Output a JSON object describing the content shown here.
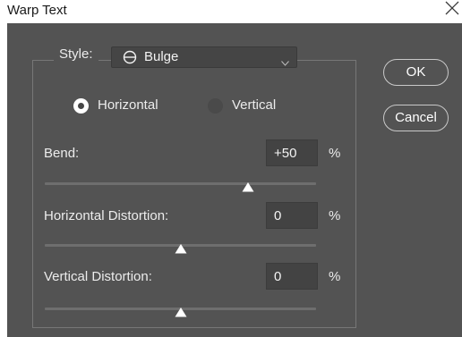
{
  "window": {
    "title": "Warp Text"
  },
  "style": {
    "label": "Style:",
    "selected": "Bulge",
    "icon": "bulge-shape-icon"
  },
  "orientation": {
    "options": [
      {
        "label": "Horizontal",
        "selected": true
      },
      {
        "label": "Vertical",
        "selected": false
      }
    ]
  },
  "fields": {
    "bend": {
      "label": "Bend:",
      "value": "+50",
      "unit": "%",
      "slider_fraction": 0.75
    },
    "horizontal_distortion": {
      "label": "Horizontal Distortion:",
      "value": "0",
      "unit": "%",
      "slider_fraction": 0.5
    },
    "vertical_distortion": {
      "label": "Vertical Distortion:",
      "value": "0",
      "unit": "%",
      "slider_fraction": 0.5
    }
  },
  "buttons": {
    "ok": "OK",
    "cancel": "Cancel"
  },
  "colors": {
    "panel_bg": "#535353",
    "text": "#ececec",
    "field_bg": "#434343"
  }
}
